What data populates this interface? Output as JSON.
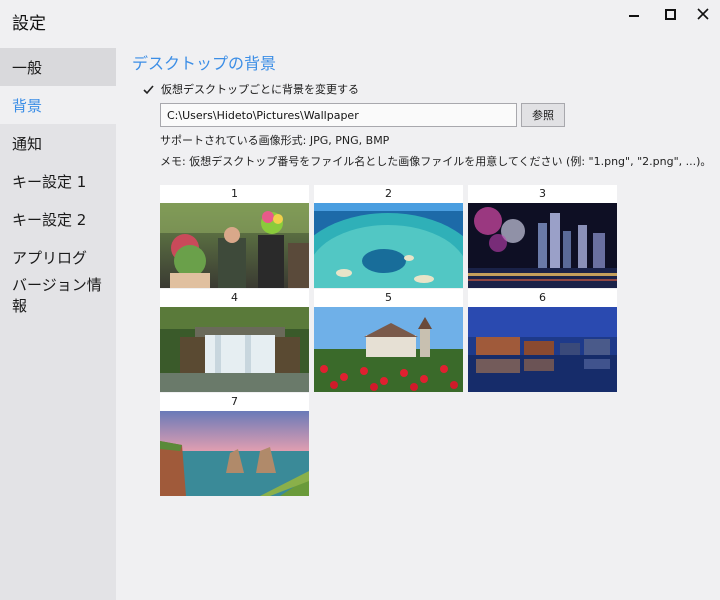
{
  "window": {
    "title": "設定",
    "controls": {
      "minimize_icon": "minimize-icon",
      "maximize_icon": "maximize-icon",
      "close_icon": "close-icon"
    }
  },
  "sidebar": {
    "items": [
      {
        "label": "一般"
      },
      {
        "label": "背景",
        "selected": true
      },
      {
        "label": "通知"
      },
      {
        "label": "キー設定 1"
      },
      {
        "label": "キー設定 2"
      },
      {
        "label": "アプリログ"
      },
      {
        "label": "バージョン情報"
      }
    ]
  },
  "background": {
    "section_title": "デスクトップの背景",
    "checkbox_label": "仮想デスクトップごとに背景を変更する",
    "checkbox_checked": true,
    "folder_path": "C:\\Users\\Hideto\\Pictures\\Wallpaper",
    "browse_label": "参照",
    "supported_formats": "サポートされている画像形式: JPG, PNG, BMP",
    "memo": "メモ: 仮想デスクトップ番号をファイル名とした画像ファイルを用意してください (例: \"1.png\", \"2.png\", ...)。",
    "wallpapers": [
      {
        "label": "1"
      },
      {
        "label": "2"
      },
      {
        "label": "3"
      },
      {
        "label": "4"
      },
      {
        "label": "5"
      },
      {
        "label": "6"
      },
      {
        "label": "7"
      }
    ]
  },
  "colors": {
    "accent": "#3c8ee6",
    "sidebar_bg": "#e3e3e6",
    "window_bg": "#f0f0f2"
  }
}
